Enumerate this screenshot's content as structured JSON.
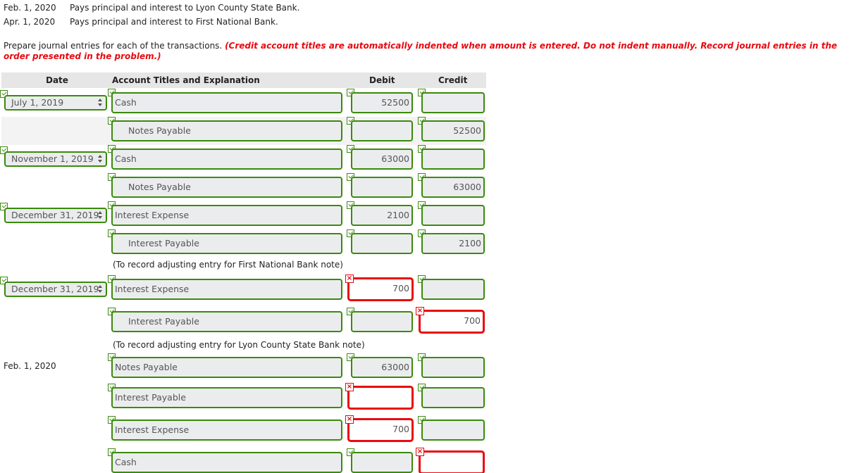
{
  "transactions": [
    {
      "date": "Feb. 1, 2020",
      "desc": "Pays principal and interest to Lyon County State Bank."
    },
    {
      "date": "Apr. 1, 2020",
      "desc": "Pays principal and interest to First National Bank."
    }
  ],
  "instructions": {
    "text": "Prepare journal entries for each of the transactions. ",
    "note": "(Credit account titles are automatically indented when amount is entered. Do not indent manually. Record journal entries in the order presented in the problem.)"
  },
  "table": {
    "headers": {
      "date": "Date",
      "account": "Account Titles and Explanation",
      "debit": "Debit",
      "credit": "Credit"
    },
    "rows": [
      {
        "date": "July 1, 2019",
        "account": "Cash",
        "debit": "52500",
        "credit": ""
      },
      {
        "date": "",
        "account": "Notes Payable",
        "debit": "",
        "credit": "52500"
      },
      {
        "date": "November 1, 2019",
        "account": "Cash",
        "debit": "63000",
        "credit": ""
      },
      {
        "date": "",
        "account": "Notes Payable",
        "debit": "",
        "credit": "63000"
      },
      {
        "date": "December 31, 2019",
        "account": "Interest Expense",
        "debit": "2100",
        "credit": ""
      },
      {
        "date": "",
        "account": "Interest Payable",
        "debit": "",
        "credit": "2100"
      },
      {
        "date": "December 31, 2019",
        "account": "Interest Expense",
        "debit": "700",
        "credit": ""
      },
      {
        "date": "",
        "account": "Interest Payable",
        "debit": "",
        "credit": "700"
      },
      {
        "date": "Feb. 1, 2020",
        "account": "Notes Payable",
        "debit": "63000",
        "credit": ""
      },
      {
        "date": "",
        "account": "Interest Payable",
        "debit": "",
        "credit": ""
      },
      {
        "date": "",
        "account": "Interest Expense",
        "debit": "700",
        "credit": ""
      },
      {
        "date": "",
        "account": "Cash",
        "debit": "",
        "credit": ""
      }
    ],
    "notes": [
      "(To record adjusting entry for First National Bank note)",
      "(To record adjusting entry for Lyon County State Bank note)"
    ]
  },
  "status_colors": {
    "correct": "#3a8a0c",
    "incorrect": "#e8090f"
  }
}
